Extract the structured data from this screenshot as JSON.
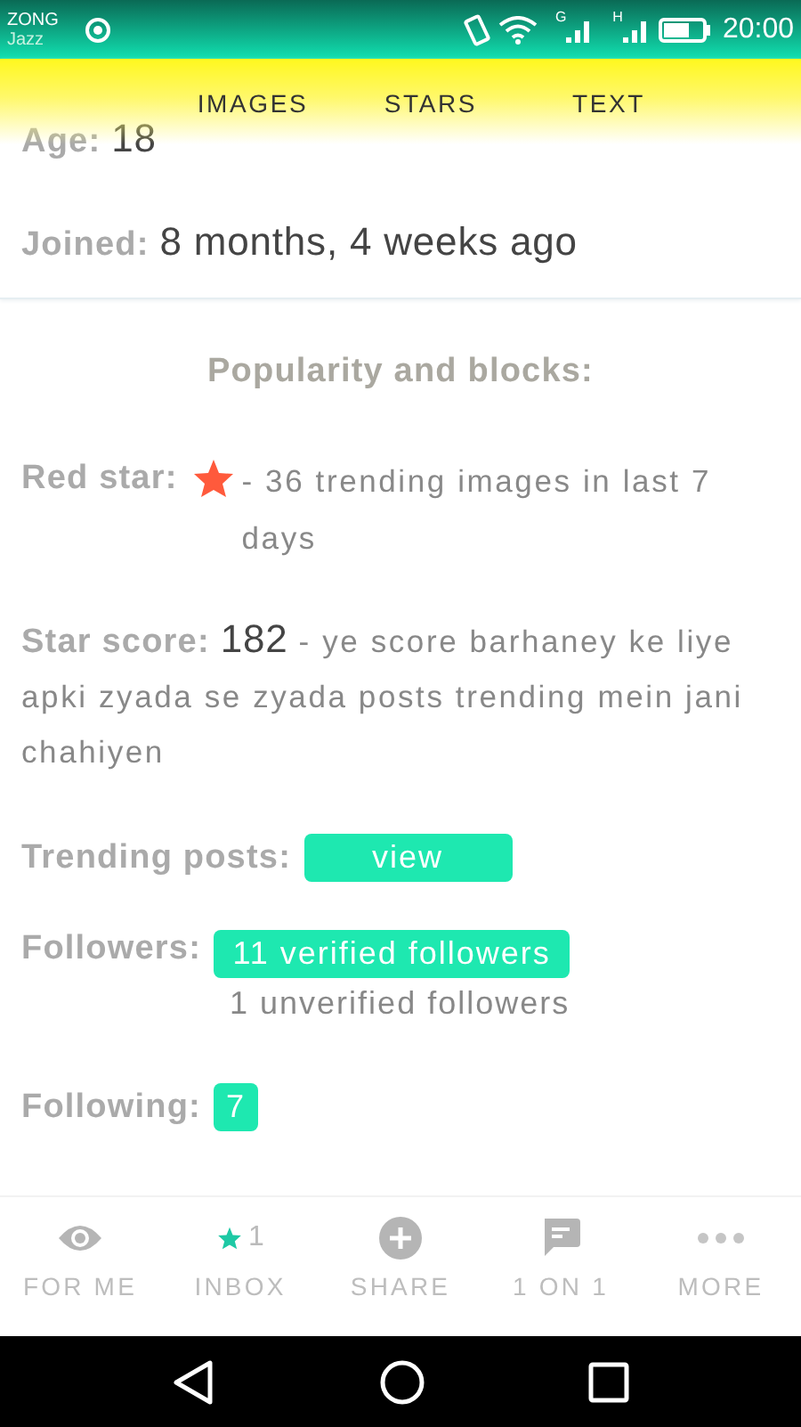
{
  "status_bar": {
    "carrier": "ZONG",
    "carrier_2": "Jazz",
    "network_1": "G",
    "network_2": "H",
    "time": "20:00"
  },
  "tabs": [
    {
      "label": "IMAGES"
    },
    {
      "label": "STARS"
    },
    {
      "label": "TEXT"
    }
  ],
  "profile": {
    "age": {
      "label": "Age:",
      "value": "18"
    },
    "joined": {
      "label": "Joined:",
      "value": "8 months, 4 weeks ago"
    }
  },
  "popularity": {
    "heading": "Popularity and blocks:",
    "red_star": {
      "label": "Red star:",
      "note": "- 36 trending images in last 7 days"
    },
    "star_score": {
      "label": "Star score:",
      "value": "182",
      "note": "- ye score barhaney ke liye apki zyada se zyada posts trending mein jani chahiyen"
    },
    "trending_posts": {
      "label": "Trending posts:",
      "button": "view"
    },
    "followers": {
      "label": "Followers:",
      "verified": "11 verified followers",
      "unverified": "1 unverified followers"
    },
    "following": {
      "label": "Following:",
      "count": "7"
    }
  },
  "bottom_nav": [
    {
      "label": "FOR ME"
    },
    {
      "label": "INBOX",
      "badge": "1"
    },
    {
      "label": "SHARE"
    },
    {
      "label": "1 ON 1"
    },
    {
      "label": "MORE"
    }
  ]
}
